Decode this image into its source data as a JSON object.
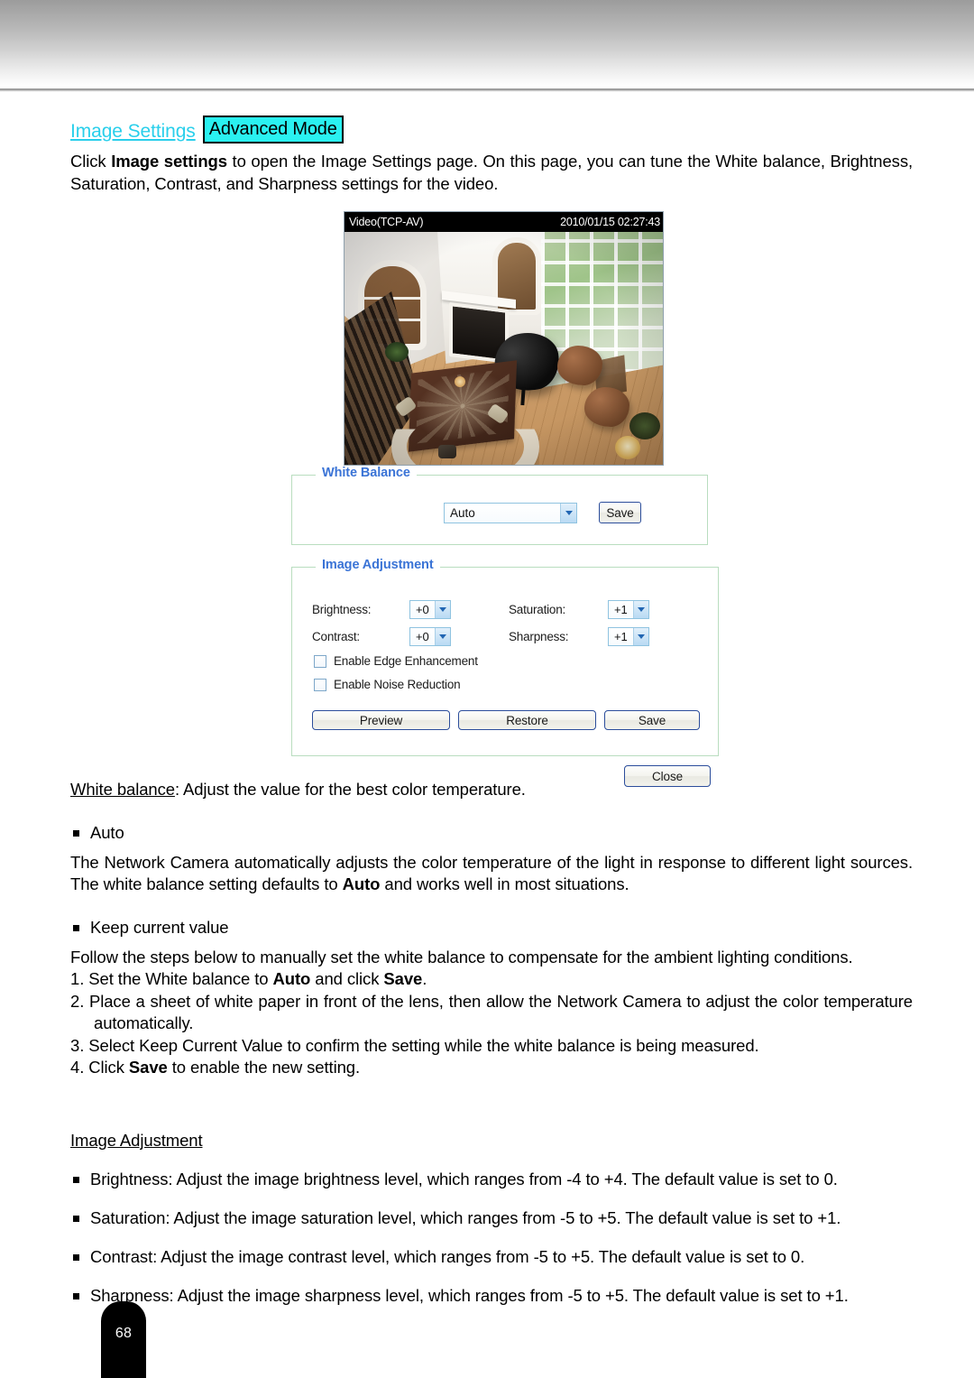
{
  "page": {
    "number": "68"
  },
  "heading": {
    "title": "Image Settings",
    "mode_badge": "Advanced Mode"
  },
  "intro": {
    "text_before_bold": "Click ",
    "bold": "Image settings",
    "text_after_bold": " to open the Image Settings page. On this page, you can tune the White balance, Brightness, Saturation, Contrast, and Sharpness settings for the video."
  },
  "screenshot": {
    "video": {
      "stream_label": "Video(TCP-AV)",
      "timestamp": "2010/01/15 02:27:43"
    },
    "white_balance": {
      "legend": "White Balance",
      "select_value": "Auto",
      "save_label": "Save"
    },
    "image_adjustment": {
      "legend": "Image Adjustment",
      "fields": [
        {
          "label": "Brightness:",
          "value": "+0"
        },
        {
          "label": "Contrast:",
          "value": "+0"
        },
        {
          "label": "Saturation:",
          "value": "+1"
        },
        {
          "label": "Sharpness:",
          "value": "+1"
        }
      ],
      "checkboxes": [
        {
          "label": "Enable Edge Enhancement",
          "checked": false
        },
        {
          "label": "Enable Noise Reduction",
          "checked": false
        }
      ],
      "buttons": {
        "preview": "Preview",
        "restore": "Restore",
        "save": "Save"
      }
    },
    "close_label": "Close"
  },
  "sections": {
    "white_balance": {
      "lead_underlined": "White balance",
      "lead_rest": ": Adjust the value for the best color temperature.",
      "auto_bullet": "Auto",
      "auto_text_1": "The Network Camera automatically adjusts the color temperature of the light in response to different light sources. The white balance setting defaults to ",
      "auto_bold": "Auto",
      "auto_text_2": " and works well in most situations.",
      "keep_bullet": "Keep current value",
      "keep_text": "Follow the steps below to manually set the white balance to compensate for the ambient lighting conditions.",
      "steps": [
        {
          "num": "1.",
          "pre": "Set the White balance to ",
          "b1": "Auto",
          "mid": " and click ",
          "b2": "Save",
          "post": "."
        },
        {
          "num": "2.",
          "pre": "Place a sheet of white paper in front of the lens, then allow the Network Camera to adjust the color temperature automatically.",
          "b1": "",
          "mid": "",
          "b2": "",
          "post": ""
        },
        {
          "num": "3.",
          "pre": "Select Keep Current Value to confirm the setting while the white balance is being measured.",
          "b1": "",
          "mid": "",
          "b2": "",
          "post": ""
        },
        {
          "num": "4.",
          "pre": "Click ",
          "b1": "Save",
          "mid": " to enable the new setting.",
          "b2": "",
          "post": ""
        }
      ]
    },
    "image_adjustment": {
      "title": "Image Adjustment",
      "bullets": [
        "Brightness: Adjust the image brightness level, which ranges from -4 to +4. The default value is set to 0.",
        "Saturation: Adjust the image saturation level, which ranges from -5 to +5. The default value is set to +1.",
        "Contrast: Adjust the image contrast level, which ranges from -5 to +5. The default value is set to 0.",
        "Sharpness: Adjust the image sharpness level, which ranges from -5 to +5. The default value is set to +1."
      ]
    }
  }
}
